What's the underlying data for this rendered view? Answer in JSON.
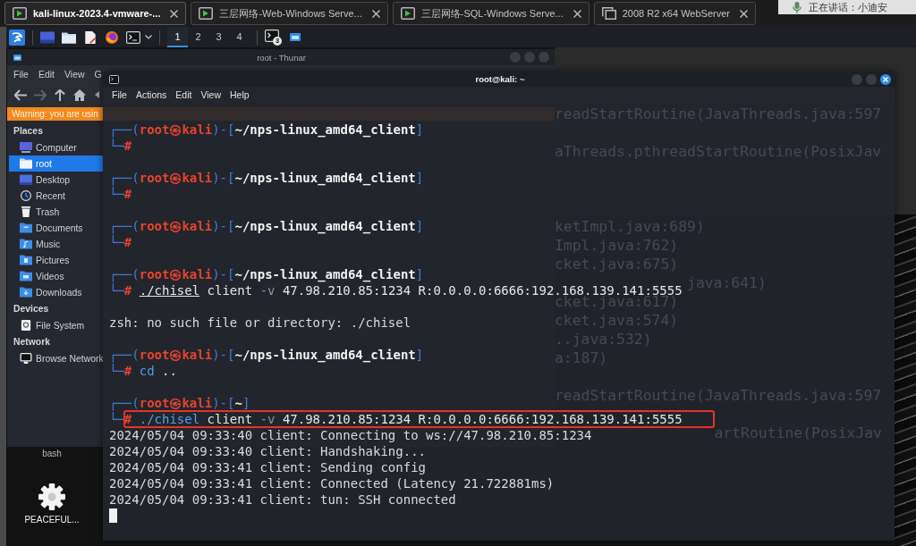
{
  "vm_tabs": [
    {
      "title": "kali-linux-2023.4-vmware-...",
      "kind": "vm",
      "selected": true
    },
    {
      "title": "三层网络-Web-Windows Serve...",
      "kind": "vm",
      "selected": false
    },
    {
      "title": "三层网络-SQL-Windows Serve...",
      "kind": "vm",
      "selected": false
    },
    {
      "title": "2008 R2 x64 WebServer",
      "kind": "clone",
      "selected": false
    }
  ],
  "notification": {
    "text": "正在讲话：小迪安"
  },
  "panel": {
    "workspaces": [
      {
        "label": "1",
        "selected": true
      },
      {
        "label": "2",
        "selected": false
      },
      {
        "label": "3",
        "selected": false
      },
      {
        "label": "4",
        "selected": false
      }
    ],
    "window_count": "3"
  },
  "thunar": {
    "title": "root - Thunar",
    "menu": [
      "File",
      "Edit",
      "View",
      "G"
    ],
    "warning": "Warning: you are usin",
    "sections": [
      {
        "heading": "Places",
        "items": [
          {
            "label": "Computer",
            "kind": "computer",
            "selected": false
          },
          {
            "label": "root",
            "kind": "home",
            "selected": true
          },
          {
            "label": "Desktop",
            "kind": "desktop",
            "selected": false
          },
          {
            "label": "Recent",
            "kind": "recent",
            "selected": false
          },
          {
            "label": "Trash",
            "kind": "trash",
            "selected": false
          },
          {
            "label": "Documents",
            "kind": "documents",
            "selected": false
          },
          {
            "label": "Music",
            "kind": "music",
            "selected": false
          },
          {
            "label": "Pictures",
            "kind": "pictures",
            "selected": false
          },
          {
            "label": "Videos",
            "kind": "videos",
            "selected": false
          },
          {
            "label": "Downloads",
            "kind": "downloads",
            "selected": false
          }
        ]
      },
      {
        "heading": "Devices",
        "items": [
          {
            "label": "File System",
            "kind": "drive",
            "selected": false
          }
        ]
      },
      {
        "heading": "Network",
        "items": [
          {
            "label": "Browse Network",
            "kind": "network",
            "selected": false
          }
        ]
      }
    ]
  },
  "terminal": {
    "title": "root@kali: ~",
    "menu": [
      "File",
      "Actions",
      "Edit",
      "View",
      "Help"
    ],
    "background_text": [
      {
        "kind": "left",
        "text": "readStartRoutine(JavaThreads.java:597"
      },
      {
        "kind": "blank"
      },
      {
        "kind": "left",
        "text": "aThreads.pthreadStartRoutine(PosixJav"
      },
      {
        "kind": "blank"
      },
      {
        "kind": "blank"
      },
      {
        "kind": "blank"
      },
      {
        "kind": "left",
        "text": "ketImpl.java:689)"
      },
      {
        "kind": "left",
        "text": "Impl.java:762)"
      },
      {
        "kind": "left",
        "text": "cket.java:675)"
      },
      {
        "kind": "indent",
        "text": "java:641)"
      },
      {
        "kind": "left",
        "text": "cket.java:617)"
      },
      {
        "kind": "left",
        "text": "cket.java:574)"
      },
      {
        "kind": "left",
        "text": "..java:532)"
      },
      {
        "kind": "left",
        "text": "a:187)"
      },
      {
        "kind": "blank"
      },
      {
        "kind": "left",
        "text": "readStartRoutine(JavaThreads.java:597"
      },
      {
        "kind": "blank"
      },
      {
        "kind": "right",
        "text": "artRoutine(PosixJav"
      }
    ],
    "lines": [
      {
        "kind": "blank"
      },
      {
        "kind": "prompt",
        "segments": [
          {
            "text": "┌──(",
            "kind": "frame"
          },
          {
            "text": "root㉿kali",
            "kind": "user"
          },
          {
            "text": ")-[",
            "kind": "frame"
          },
          {
            "text": "~/nps-linux_amd64_client",
            "kind": "path"
          },
          {
            "text": "]",
            "kind": "frame"
          }
        ]
      },
      {
        "kind": "input",
        "highlighted": false,
        "segments": [
          {
            "text": "└─",
            "kind": "frame"
          },
          {
            "text": "#",
            "kind": "hash"
          }
        ]
      },
      {
        "kind": "blank"
      },
      {
        "kind": "prompt",
        "segments": [
          {
            "text": "┌──(",
            "kind": "frame"
          },
          {
            "text": "root㉿kali",
            "kind": "user"
          },
          {
            "text": ")-[",
            "kind": "frame"
          },
          {
            "text": "~/nps-linux_amd64_client",
            "kind": "path"
          },
          {
            "text": "]",
            "kind": "frame"
          }
        ]
      },
      {
        "kind": "input",
        "highlighted": false,
        "segments": [
          {
            "text": "└─",
            "kind": "frame"
          },
          {
            "text": "#",
            "kind": "hash"
          }
        ]
      },
      {
        "kind": "blank"
      },
      {
        "kind": "prompt",
        "segments": [
          {
            "text": "┌──(",
            "kind": "frame"
          },
          {
            "text": "root㉿kali",
            "kind": "user"
          },
          {
            "text": ")-[",
            "kind": "frame"
          },
          {
            "text": "~/nps-linux_amd64_client",
            "kind": "path"
          },
          {
            "text": "]",
            "kind": "frame"
          }
        ]
      },
      {
        "kind": "input",
        "highlighted": false,
        "segments": [
          {
            "text": "└─",
            "kind": "frame"
          },
          {
            "text": "#",
            "kind": "hash"
          }
        ]
      },
      {
        "kind": "blank"
      },
      {
        "kind": "prompt",
        "segments": [
          {
            "text": "┌──(",
            "kind": "frame"
          },
          {
            "text": "root㉿kali",
            "kind": "user"
          },
          {
            "text": ")-[",
            "kind": "frame"
          },
          {
            "text": "~/nps-linux_amd64_client",
            "kind": "path"
          },
          {
            "text": "]",
            "kind": "frame"
          }
        ]
      },
      {
        "kind": "input",
        "highlighted": false,
        "segments": [
          {
            "text": "└─",
            "kind": "frame"
          },
          {
            "text": "# ",
            "kind": "hash"
          },
          {
            "text": "./chisel",
            "kind": "missing"
          },
          {
            "text": " client ",
            "kind": "plain"
          },
          {
            "text": "-v",
            "kind": "option"
          },
          {
            "text": " 47.98.210.85:1234 R:0.0.0.0:6666:192.168.139.141:5555",
            "kind": "plain"
          }
        ]
      },
      {
        "kind": "blank"
      },
      {
        "kind": "output",
        "text": "zsh: no such file or directory: ./chisel"
      },
      {
        "kind": "blank"
      },
      {
        "kind": "prompt",
        "segments": [
          {
            "text": "┌──(",
            "kind": "frame"
          },
          {
            "text": "root㉿kali",
            "kind": "user"
          },
          {
            "text": ")-[",
            "kind": "frame"
          },
          {
            "text": "~/nps-linux_amd64_client",
            "kind": "path"
          },
          {
            "text": "]",
            "kind": "frame"
          }
        ]
      },
      {
        "kind": "input",
        "highlighted": false,
        "segments": [
          {
            "text": "└─",
            "kind": "frame"
          },
          {
            "text": "# ",
            "kind": "hash"
          },
          {
            "text": "cd",
            "kind": "command"
          },
          {
            "text": " ..",
            "kind": "plain"
          }
        ]
      },
      {
        "kind": "blank"
      },
      {
        "kind": "prompt",
        "segments": [
          {
            "text": "┌──(",
            "kind": "frame"
          },
          {
            "text": "root㉿kali",
            "kind": "user"
          },
          {
            "text": ")-[",
            "kind": "frame"
          },
          {
            "text": "~",
            "kind": "path"
          },
          {
            "text": "]",
            "kind": "frame"
          }
        ]
      },
      {
        "kind": "input",
        "highlighted": true,
        "segments": [
          {
            "text": "└─",
            "kind": "frame"
          },
          {
            "text": "# ",
            "kind": "hash"
          },
          {
            "text": "./chisel",
            "kind": "command"
          },
          {
            "text": " client ",
            "kind": "plain"
          },
          {
            "text": "-v",
            "kind": "option"
          },
          {
            "text": " 47.98.210.85:1234 R:0.0.0.0:6666:192.168.139.141:5555",
            "kind": "plain"
          }
        ]
      },
      {
        "kind": "output",
        "text": "2024/05/04 09:33:40 client: Connecting to ws://47.98.210.85:1234"
      },
      {
        "kind": "output",
        "text": "2024/05/04 09:33:40 client: Handshaking..."
      },
      {
        "kind": "output",
        "text": "2024/05/04 09:33:41 client: Sending config"
      },
      {
        "kind": "output",
        "text": "2024/05/04 09:33:41 client: Connected (Latency 21.722881ms)"
      },
      {
        "kind": "output",
        "text": "2024/05/04 09:33:41 client: tun: SSH connected"
      },
      {
        "kind": "cursor"
      }
    ]
  },
  "desktop_icons": [
    {
      "label": "bash",
      "kind": "covered"
    },
    {
      "label": "PEACEFUL...",
      "kind": "gear"
    }
  ]
}
